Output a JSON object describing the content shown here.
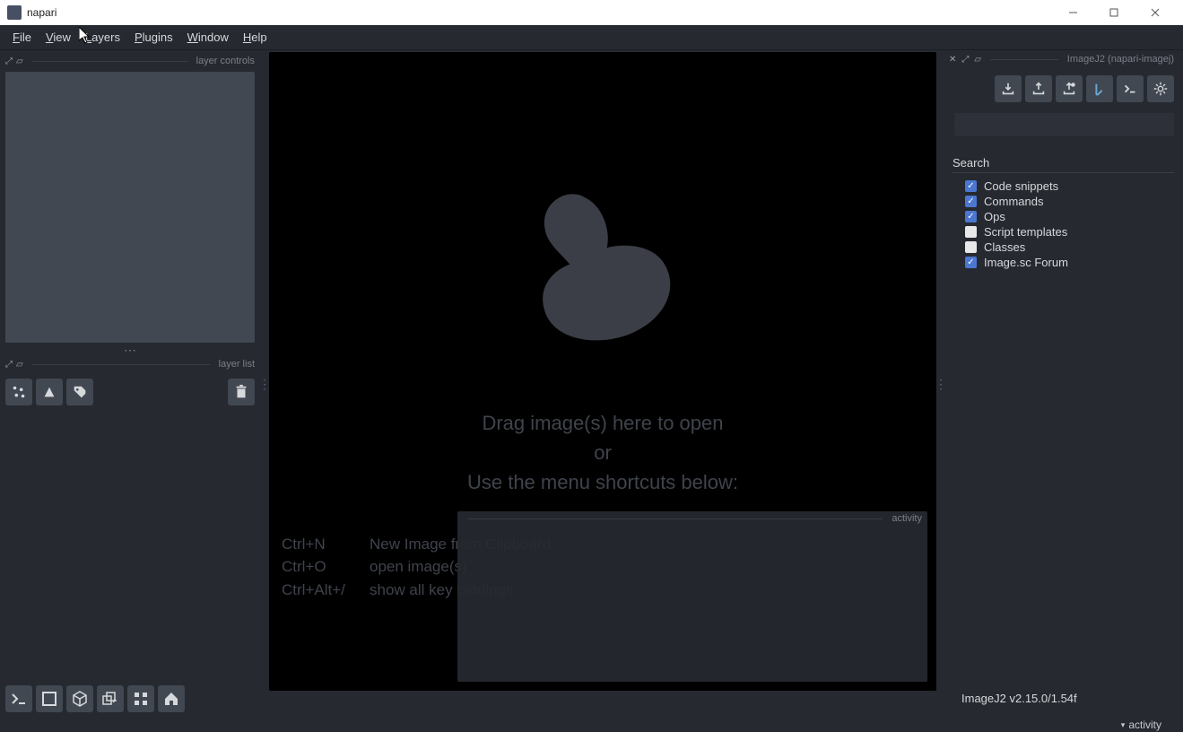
{
  "window": {
    "title": "napari"
  },
  "menubar": {
    "items": [
      {
        "label": "File",
        "ul": "F",
        "rest": "ile"
      },
      {
        "label": "View",
        "ul": "V",
        "rest": "iew"
      },
      {
        "label": "Layers",
        "ul": "L",
        "rest": "ayers"
      },
      {
        "label": "Plugins",
        "ul": "P",
        "rest": "lugins"
      },
      {
        "label": "Window",
        "ul": "W",
        "rest": "indow"
      },
      {
        "label": "Help",
        "ul": "H",
        "rest": "elp"
      }
    ]
  },
  "left": {
    "controls_title": "layer controls",
    "list_title": "layer list"
  },
  "canvas": {
    "help_line1": "Drag image(s) here to open",
    "help_line2": "or",
    "help_line3": "Use the menu shortcuts below:",
    "shortcuts": [
      {
        "key": "Ctrl+N",
        "desc": "New Image from Clipboard"
      },
      {
        "key": "Ctrl+O",
        "desc": "open image(s)"
      },
      {
        "key": "Ctrl+Alt+/",
        "desc": "show all key bindings"
      }
    ],
    "activity_title": "activity"
  },
  "right": {
    "dock_title": "ImageJ2 (napari-imagej)",
    "search_label": "Search",
    "filters": [
      {
        "label": "Code snippets",
        "checked": true
      },
      {
        "label": "Commands",
        "checked": true
      },
      {
        "label": "Ops",
        "checked": true
      },
      {
        "label": "Script templates",
        "checked": false
      },
      {
        "label": "Classes",
        "checked": false
      },
      {
        "label": "Image.sc Forum",
        "checked": true
      }
    ],
    "version": "ImageJ2 v2.15.0/1.54f"
  },
  "statusbar": {
    "activity": "activity"
  }
}
